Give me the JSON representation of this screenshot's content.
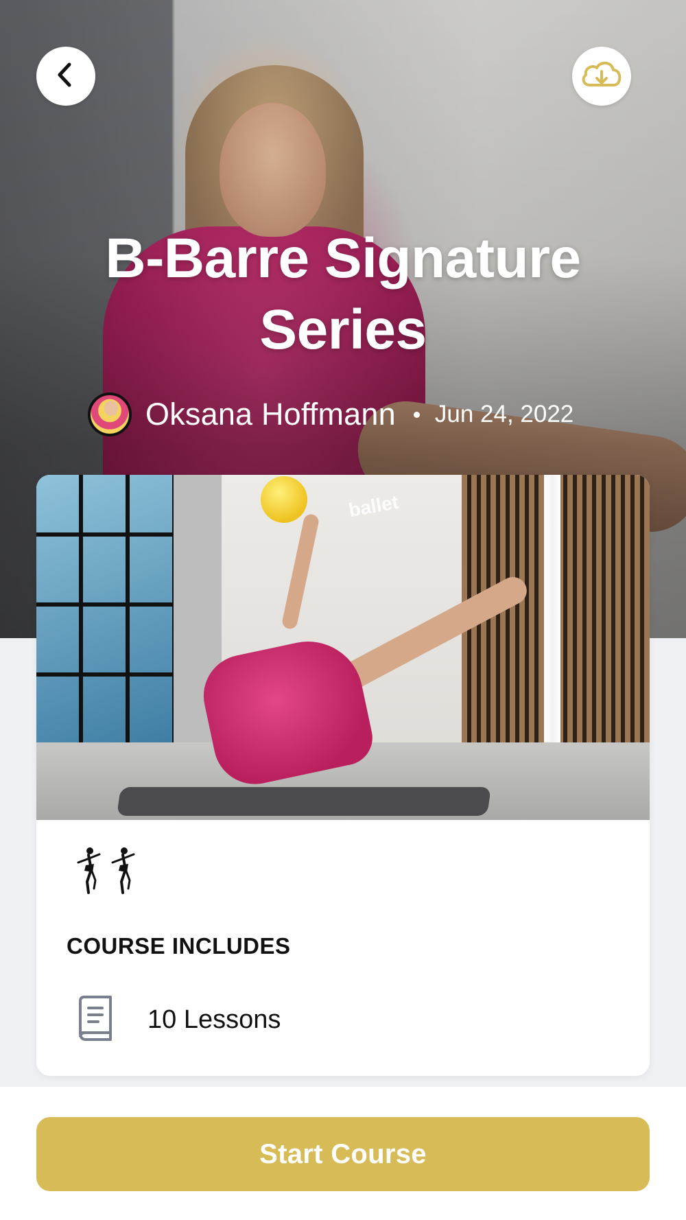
{
  "header": {
    "back_icon": "chevron-left-icon",
    "download_icon": "cloud-download-icon"
  },
  "course": {
    "title": "B-Barre Signature Series",
    "author": "Oksana Hoffmann",
    "date": "Jun 24, 2022",
    "image_logo_text": "ballet"
  },
  "includes": {
    "heading": "COURSE INCLUDES",
    "lessons_label": "10 Lessons"
  },
  "actions": {
    "start_label": "Start Course"
  },
  "colors": {
    "accent": "#d6bb57",
    "background": "#eef0f4",
    "card": "#ffffff"
  }
}
